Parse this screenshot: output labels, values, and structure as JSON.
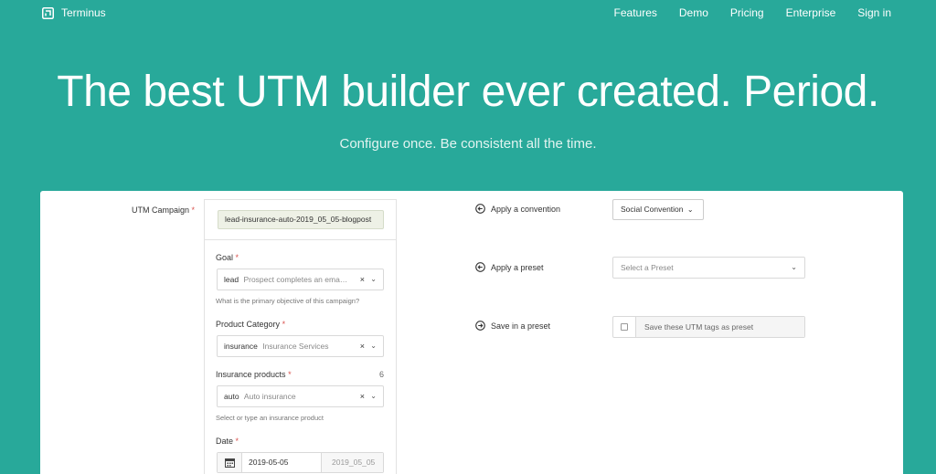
{
  "nav": {
    "brand": "Terminus",
    "links": [
      "Features",
      "Demo",
      "Pricing",
      "Enterprise",
      "Sign in"
    ]
  },
  "hero": {
    "title": "The best UTM builder ever created. Period.",
    "subtitle": "Configure once. Be consistent all the time."
  },
  "form": {
    "utm_campaign_label": "UTM Campaign",
    "utm_campaign_value": "lead-insurance-auto-2019_05_05-blogpost",
    "goal": {
      "label": "Goal",
      "code": "lead",
      "description": "Prospect completes an ema…",
      "help": "What is the primary objective of this campaign?"
    },
    "product_category": {
      "label": "Product Category",
      "code": "insurance",
      "description": "Insurance Services"
    },
    "insurance_products": {
      "label": "Insurance products",
      "count": "6",
      "code": "auto",
      "description": "Auto insurance",
      "help": "Select or type an insurance product"
    },
    "date": {
      "label": "Date",
      "value": "2019-05-05",
      "formatted": "2019_05_05"
    },
    "required_mark": "*",
    "clear_glyph": "×",
    "caret_glyph": "⌄"
  },
  "actions": {
    "convention": {
      "label": "Apply a convention",
      "value": "Social Convention"
    },
    "preset": {
      "label": "Apply a preset",
      "placeholder": "Select a Preset"
    },
    "save": {
      "label": "Save in a preset",
      "checkbox_text": "Save these UTM tags as preset"
    }
  },
  "colors": {
    "background": "#28a99a",
    "panel": "#ffffff",
    "required": "#d9534f"
  }
}
